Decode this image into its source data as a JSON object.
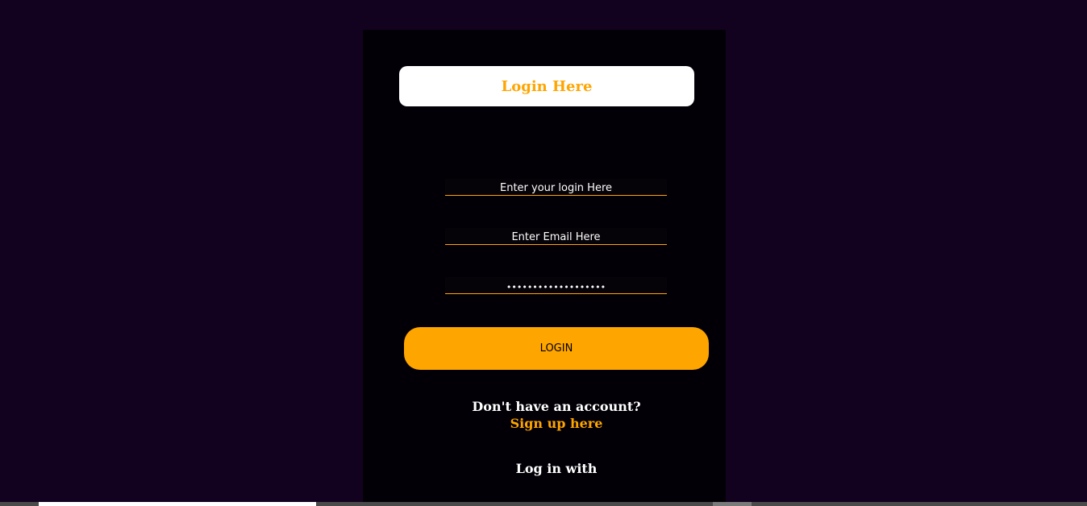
{
  "form": {
    "title": "Login Here",
    "login_placeholder": "Enter your login Here",
    "email_placeholder": "Enter Email Here",
    "password_value": "•••••••••••••••••••",
    "login_button": "LOGIN",
    "no_account_text": "Don't have an account?",
    "signup_link": "Sign up here",
    "login_with": "Log in with"
  },
  "colors": {
    "background": "#12021f",
    "panel": "#020006",
    "accent": "#ffa500",
    "title_box": "#ffffff"
  }
}
